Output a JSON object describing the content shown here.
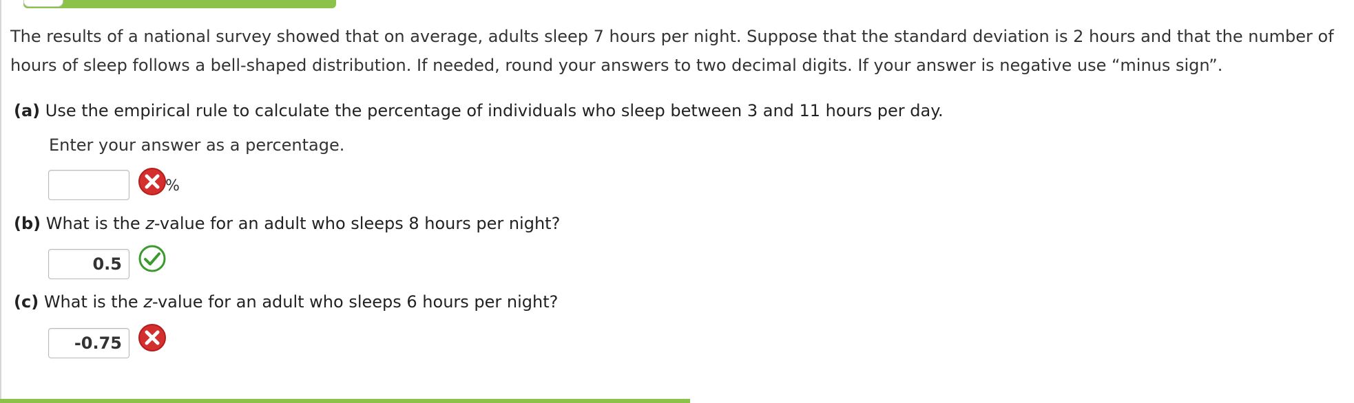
{
  "intro": {
    "line1": "The results of a national survey showed that on average, adults sleep 7 hours per night. Suppose that the standard deviation is 2 hours and that the number of",
    "line2": "hours of sleep follows a bell-shaped distribution. If needed, round your answers to two decimal digits. If your answer is negative use “minus sign”."
  },
  "parts": [
    {
      "label": "(a)",
      "question": "Use the empirical rule to calculate the percentage of individuals who sleep between 3 and 11 hours per day.",
      "note": "Enter your answer as a percentage.",
      "value": "",
      "unit": "%",
      "status": "incorrect",
      "status_icon": "x-circle-icon"
    },
    {
      "label": "(b)",
      "question_pre": "What is the ",
      "question_var": "z",
      "question_post": "-value for an adult who sleeps 8 hours per night?",
      "value": "0.5",
      "status": "correct",
      "status_icon": "check-circle-icon"
    },
    {
      "label": "(c)",
      "question_pre": "What is the ",
      "question_var": "z",
      "question_post": "-value for an adult who sleeps 6 hours per night?",
      "value": "-0.75",
      "status": "incorrect",
      "status_icon": "x-circle-icon"
    }
  ],
  "colors": {
    "accent_green": "#8bc34a",
    "correct_green": "#3a9a2e",
    "incorrect_red": "#d32f2f"
  }
}
